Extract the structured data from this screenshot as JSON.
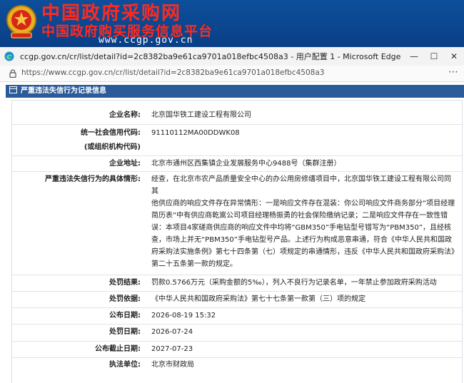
{
  "banner": {
    "title": "中国政府采购网",
    "subtitle": "中国政府购买服务信息平台",
    "url": "www.ccgp.gov.cn"
  },
  "window": {
    "title": "ccgp.gov.cn/cr/list/detail?id=2c8382ba9e61ca9701a018efbc4508a3 - 用户配置 1 - Microsoft Edge",
    "url": "https://www.ccgp.gov.cn/cr/list/detail?id=2c8382ba9e61ca9701a018efbc4508a3"
  },
  "section": {
    "header": "严重违法失信行为记录信息"
  },
  "record": {
    "company_label": "企业名称:",
    "company": "北京国华铁工建设工程有限公司",
    "credit_code_label": "统一社会信用代码:",
    "credit_code_label2": "(或组织机构代码)",
    "credit_code": "91110112MA00DDWK08",
    "address_label": "企业地址:",
    "address": "北京市通州区西集镇企业发展服务中心9488号（集群注册）",
    "behavior_label": "严重违法失信行为的具体情形:",
    "behavior_lines": [
      "经查，在北京市农产品质量安全中心的办公用房修缮项目中，北京国华铁工建设工程有限公司同其",
      "他供应商的响应文件存在异常情形：一是响应文件存在混装：你公司响应文件商务部分“项目经理",
      "简历表”中有供应商乾嵩公司项目经理杨振勇的社会保险缴纳记录；二是响应文件存在一致性错",
      "误：本项目4家磋商供应商的响应文件中均将“GBM350”手电钻型号错写为“PBM350”，且经核",
      "查，市场上并无“PBM350”手电钻型号产品。上述行为构成恶意串通，符合《中华人民共和国政",
      "府采购法实施条例》第七十四条第（七）项规定的串通情形，违反《中华人民共和国政府采购法》",
      "第二十五条第一款的规定。"
    ],
    "penalty_label": "处罚结果:",
    "penalty": "罚款0.5766万元（采购金额的5‰），列入不良行为记录名单，一年禁止参加政府采购活动",
    "basis_label": "处罚依据:",
    "basis": "《中华人民共和国政府采购法》第七十七条第一款第（三）项的规定",
    "publish_date_label": "公布日期:",
    "publish_date": "2026-08-19 15:32",
    "penalty_date_label": "处罚日期:",
    "penalty_date": "2026-07-24",
    "end_date_label": "公布截止日期:",
    "end_date": "2027-07-23",
    "agency_label": "执法单位:",
    "agency": "北京市财政局"
  }
}
